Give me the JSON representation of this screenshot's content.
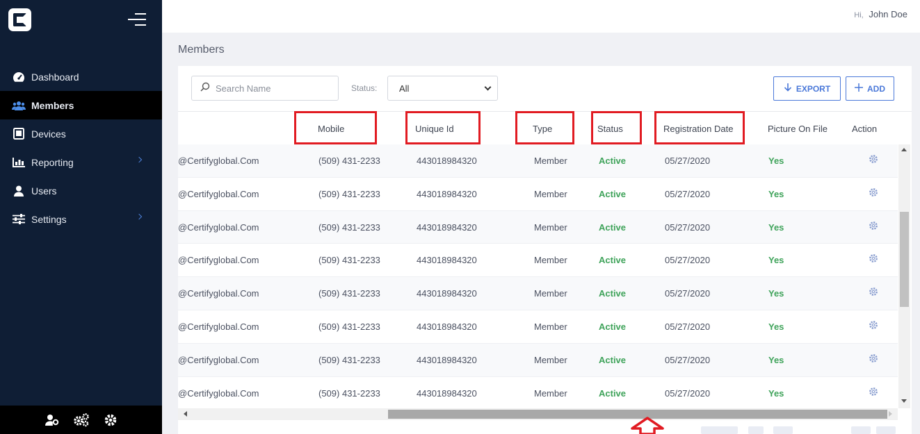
{
  "app": {
    "logo_letter": "C"
  },
  "topbar": {
    "greeting_prefix": "Hi,",
    "user_name": "John Doe"
  },
  "sidebar": {
    "items": [
      {
        "label": "Dashboard",
        "icon": "gauge-icon",
        "active": false
      },
      {
        "label": "Members",
        "icon": "users-icon",
        "active": true
      },
      {
        "label": "Devices",
        "icon": "tablet-icon",
        "active": false
      },
      {
        "label": "Reporting",
        "icon": "bar-chart-icon",
        "active": false,
        "has_submenu": true
      },
      {
        "label": "Users",
        "icon": "user-icon",
        "active": false
      },
      {
        "label": "Settings",
        "icon": "sliders-icon",
        "active": false,
        "has_submenu": true
      }
    ],
    "footer_icons": [
      "user-gear-icon",
      "gears-icon",
      "gear-icon"
    ]
  },
  "page": {
    "title": "Members"
  },
  "toolbar": {
    "search_placeholder": "Search Name",
    "status_label": "Status:",
    "status_value": "All",
    "export_label": "EXPORT",
    "add_label": "ADD"
  },
  "table": {
    "columns": [
      "Mobile",
      "Unique Id",
      "Type",
      "Status",
      "Registration Date",
      "Picture On File",
      "Action"
    ],
    "rows": [
      {
        "email": "@Certifyglobal.Com",
        "mobile": "(509) 431-2233",
        "unique_id": "443018984320",
        "type": "Member",
        "status": "Active",
        "registration_date": "05/27/2020",
        "picture": "Yes"
      },
      {
        "email": "@Certifyglobal.Com",
        "mobile": "(509) 431-2233",
        "unique_id": "443018984320",
        "type": "Member",
        "status": "Active",
        "registration_date": "05/27/2020",
        "picture": "Yes"
      },
      {
        "email": "@Certifyglobal.Com",
        "mobile": "(509) 431-2233",
        "unique_id": "443018984320",
        "type": "Member",
        "status": "Active",
        "registration_date": "05/27/2020",
        "picture": "Yes"
      },
      {
        "email": "@Certifyglobal.Com",
        "mobile": "(509) 431-2233",
        "unique_id": "443018984320",
        "type": "Member",
        "status": "Active",
        "registration_date": "05/27/2020",
        "picture": "Yes"
      },
      {
        "email": "@Certifyglobal.Com",
        "mobile": "(509) 431-2233",
        "unique_id": "443018984320",
        "type": "Member",
        "status": "Active",
        "registration_date": "05/27/2020",
        "picture": "Yes"
      },
      {
        "email": "@Certifyglobal.Com",
        "mobile": "(509) 431-2233",
        "unique_id": "443018984320",
        "type": "Member",
        "status": "Active",
        "registration_date": "05/27/2020",
        "picture": "Yes"
      },
      {
        "email": "@Certifyglobal.Com",
        "mobile": "(509) 431-2233",
        "unique_id": "443018984320",
        "type": "Member",
        "status": "Active",
        "registration_date": "05/27/2020",
        "picture": "Yes"
      },
      {
        "email": "@Certifyglobal.Com",
        "mobile": "(509) 431-2233",
        "unique_id": "443018984320",
        "type": "Member",
        "status": "Active",
        "registration_date": "05/27/2020",
        "picture": "Yes"
      }
    ]
  },
  "colors": {
    "sidebar_bg": "#0f1e35",
    "accent": "#4a78d9",
    "status_green": "#3fa35a",
    "highlight_red": "#e11b22"
  }
}
